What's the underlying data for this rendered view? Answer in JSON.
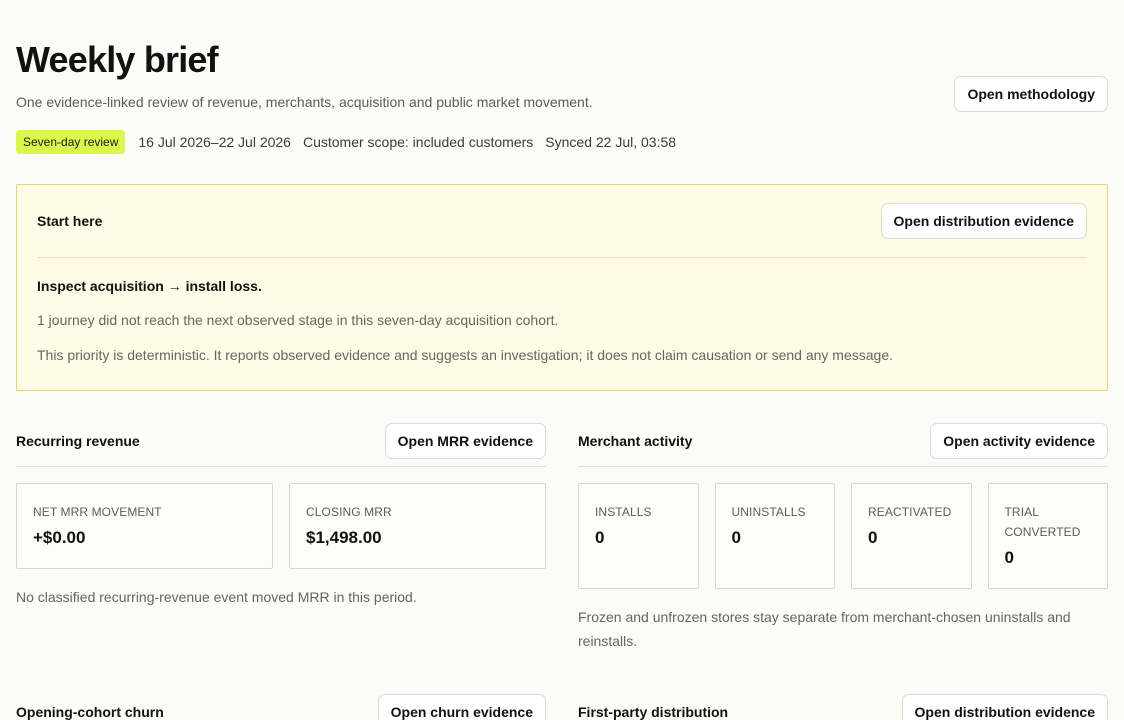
{
  "header": {
    "title": "Weekly brief",
    "subtitle": "One evidence-linked review of revenue, merchants, acquisition and public market movement.",
    "badge": "Seven-day review",
    "date_range": "16 Jul 2026–22 Jul 2026",
    "scope": "Customer scope: included customers",
    "synced": "Synced 22 Jul, 03:58",
    "methodology_button": "Open methodology"
  },
  "start_here": {
    "label": "Start here",
    "button": "Open distribution evidence",
    "title": "Inspect acquisition → install loss.",
    "detail": "1 journey did not reach the next observed stage in this seven-day acquisition cohort.",
    "disclaimer": "This priority is deterministic. It reports observed evidence and suggests an investigation; it does not claim causation or send any message."
  },
  "recurring_revenue": {
    "label": "Recurring revenue",
    "button": "Open MRR evidence",
    "cards": [
      {
        "label": "Net MRR movement",
        "value": "+$0.00"
      },
      {
        "label": "Closing MRR",
        "value": "$1,498.00"
      }
    ],
    "note": "No classified recurring-revenue event moved MRR in this period."
  },
  "merchant_activity": {
    "label": "Merchant activity",
    "button": "Open activity evidence",
    "cards": [
      {
        "label": "Installs",
        "value": "0"
      },
      {
        "label": "Uninstalls",
        "value": "0"
      },
      {
        "label": "Reactivated",
        "value": "0"
      },
      {
        "label": "Trial converted",
        "value": "0"
      }
    ],
    "note": "Frozen and unfrozen stores stay separate from merchant-chosen uninstalls and reinstalls."
  },
  "opening_cohort_churn": {
    "label": "Opening-cohort churn",
    "button": "Open churn evidence"
  },
  "first_party_distribution": {
    "label": "First-party distribution",
    "button": "Open distribution evidence"
  }
}
